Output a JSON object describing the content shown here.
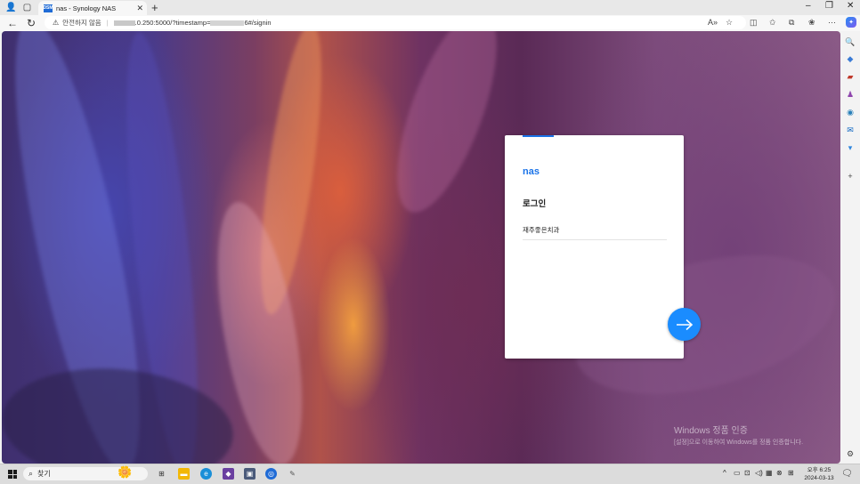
{
  "browser": {
    "tab_title": "nas - Synology NAS",
    "tab_favicon": "DSM",
    "security_label": "안전하지 않음",
    "url_visible": ".0.250:5000/?timestamp=",
    "url_tail": "6#/signin",
    "read_aloud_label": "A»"
  },
  "login": {
    "brand": "nas",
    "heading": "로그인",
    "username": "재주좋은치과",
    "accent_color": "#1a73e8",
    "button_color": "#1a8cff"
  },
  "watermark": {
    "line1": "Windows 정품 인증",
    "line2": "[설정]으로 이동하여 Windows를 정품 인증합니다."
  },
  "taskbar": {
    "search_placeholder": "찾기",
    "time": "오후 6:25",
    "date": "2024-03-13"
  },
  "icons": [
    "profile-icon",
    "tab-actions-icon",
    "close-icon",
    "new-tab-icon",
    "back-icon",
    "refresh-icon",
    "warning-icon",
    "favorite-icon",
    "collections-icon",
    "extensions-icon",
    "more-icon",
    "copilot-icon",
    "arrow-right-icon",
    "search-icon",
    "settings-icon",
    "windows-start-icon"
  ]
}
